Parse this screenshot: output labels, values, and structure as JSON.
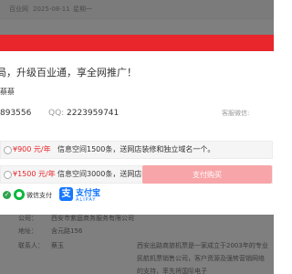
{
  "background_page": {
    "topbar": {
      "site_name": "百业网",
      "date": "2025-08-11",
      "weekday": "星期一"
    },
    "info_rows": [
      {
        "label": "公司：",
        "value": "西安市紫庭商务服务有限公司"
      },
      {
        "label": "地址：",
        "value": "含元路156"
      },
      {
        "label": "联系人：",
        "value": "蔡玉"
      }
    ],
    "intro_text": "西安出路商旅机票是一家成立于2003年的专业民航机票销售公司，客户资源及强势营销网络的支持，率先将国际电子"
  },
  "modal": {
    "headline": "局，升级百业通，享全网推广！",
    "contact": {
      "name": "蔡蔡",
      "phone": "893556",
      "qq_label": "QQ:",
      "qq": "2223959741",
      "service_label": "客服微信:"
    },
    "plans": [
      {
        "price": "¥900 元/年",
        "description": "信息空间1500条，送网店装修和独立域名一个。"
      },
      {
        "price": "¥1500 元/年",
        "description": "信息空间3000条，送网店装修和独立域名一个。"
      }
    ],
    "payment": {
      "wechat_label": "微信支付",
      "alipay_name": "支付宝",
      "alipay_sub": "ALIPAY",
      "selected": "wechat"
    },
    "pay_button_label": "支付购买"
  },
  "colors": {
    "brand_red": "#e8262c",
    "pay_button": "#f7a5a8",
    "wechat_green": "#09b83e",
    "alipay_blue": "#1677ff",
    "overlay": "rgba(0,0,0,0.5)"
  },
  "icons": {
    "selected_check": "check-circle-icon",
    "wechat": "wechat-icon",
    "alipay": "alipay-icon"
  }
}
